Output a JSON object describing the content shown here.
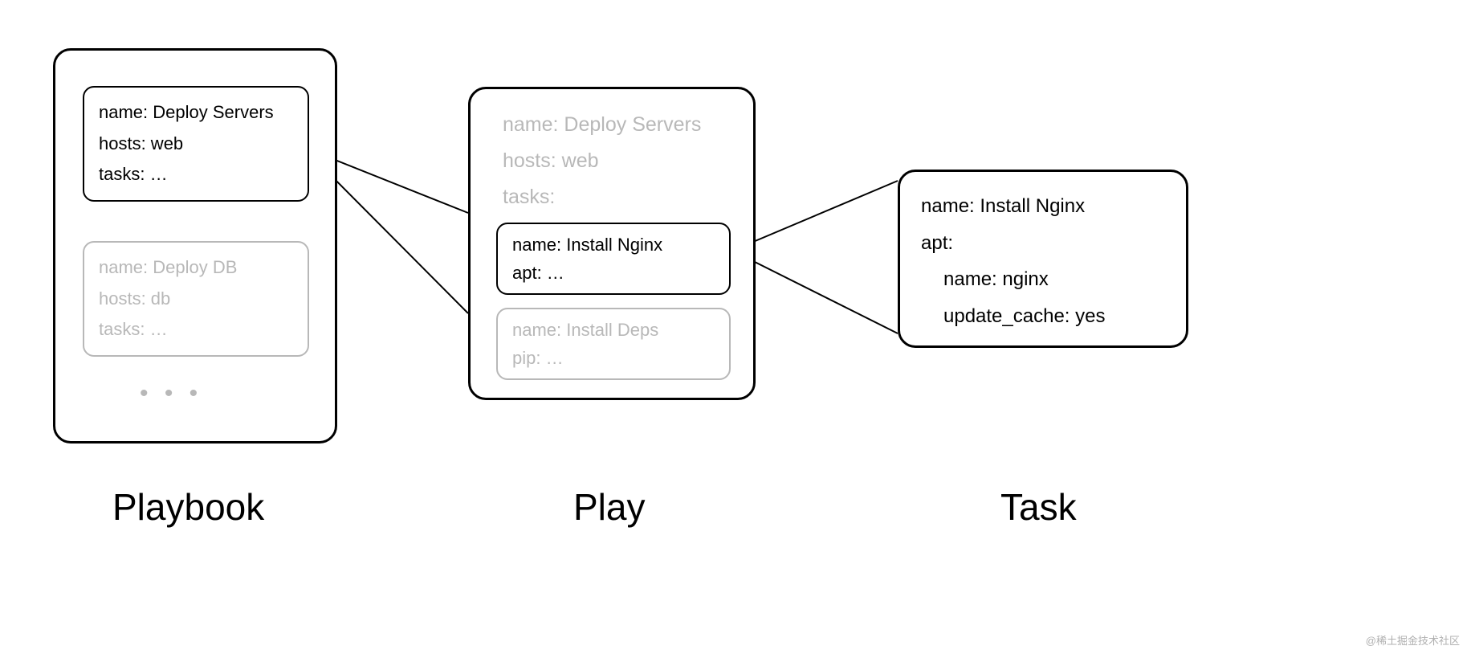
{
  "playbook": {
    "label": "Playbook",
    "play1": {
      "name": "name: Deploy Servers",
      "hosts": "hosts: web",
      "tasks": "tasks: …"
    },
    "play2": {
      "name": "name: Deploy DB",
      "hosts": "hosts: db",
      "tasks": "tasks: …"
    },
    "ellipsis": "• • •"
  },
  "play": {
    "label": "Play",
    "header": {
      "name": "name: Deploy Servers",
      "hosts": "hosts: web",
      "tasks": "tasks:"
    },
    "task1": {
      "name": "name: Install Nginx",
      "module": "apt: …"
    },
    "task2": {
      "name": "name: Install Deps",
      "module": "pip: …"
    }
  },
  "task": {
    "label": "Task",
    "name": "name: Install Nginx",
    "module": "apt:",
    "param1": "name: nginx",
    "param2": "update_cache: yes"
  },
  "watermark": "@稀土掘金技术社区"
}
